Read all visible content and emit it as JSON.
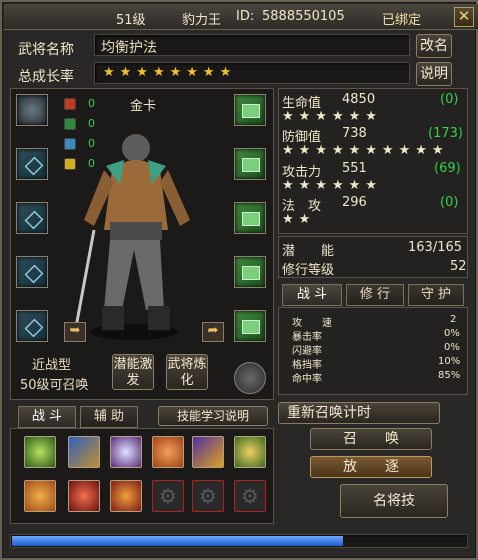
{
  "title": {
    "level": "51级",
    "name": "豹力王",
    "id_label": "ID:",
    "id_value": "5888550105",
    "status": "已绑定",
    "close": "✕"
  },
  "general": {
    "name_label": "武将名称",
    "name_value": "均衡护法",
    "rename_button": "改名",
    "growth_label": "总成长率",
    "growth_stars": "★★★★★★★★",
    "help_button": "说明"
  },
  "character": {
    "card": "金卡",
    "type": "近战型",
    "summon": "50级可召唤"
  },
  "elements": [
    {
      "icon": "fire-icon",
      "value": "0"
    },
    {
      "icon": "wood-icon",
      "value": "0"
    },
    {
      "icon": "water-icon",
      "value": "0"
    },
    {
      "icon": "thunder-icon",
      "value": "0"
    }
  ],
  "stats": [
    {
      "label": "生命值",
      "value": "4850",
      "bonus": "(0)",
      "stars": "★★★★★★"
    },
    {
      "label": "防御值",
      "value": "738",
      "bonus": "(173)",
      "stars": "★★★★★★★★★★"
    },
    {
      "label": "攻击力",
      "value": "551",
      "bonus": "(69)",
      "stars": "★★★★★★"
    },
    {
      "label": "法　攻",
      "value": "296",
      "bonus": "(0)",
      "stars": "★★"
    }
  ],
  "potential": {
    "label": "潜　　能",
    "value": "163/165"
  },
  "cultivation": {
    "label": "修行等级",
    "value": "52"
  },
  "right_tabs": [
    "战 斗",
    "修 行",
    "守 护"
  ],
  "combat_attrs": [
    {
      "label": "攻　　速",
      "value": "2"
    },
    {
      "label": "暴击率",
      "value": "0%"
    },
    {
      "label": "闪避率",
      "value": "0%"
    },
    {
      "label": "格挡率",
      "value": "10%"
    },
    {
      "label": "命中率",
      "value": "85%"
    }
  ],
  "buttons": {
    "potential": "潜能激发",
    "refine": "武将炼化",
    "recall_timer": "重新召唤计时",
    "summon": "召　　唤",
    "dismiss": "放　　逐",
    "famous_skill": "名将技",
    "skill_help": "技能学习说明"
  },
  "skill_tabs": [
    "战 斗",
    "辅 助"
  ],
  "progress": {
    "fraction": 0.73
  },
  "colors": {
    "accent": "#f2c12e",
    "green": "#35d14a",
    "frame": "#2a2826"
  }
}
